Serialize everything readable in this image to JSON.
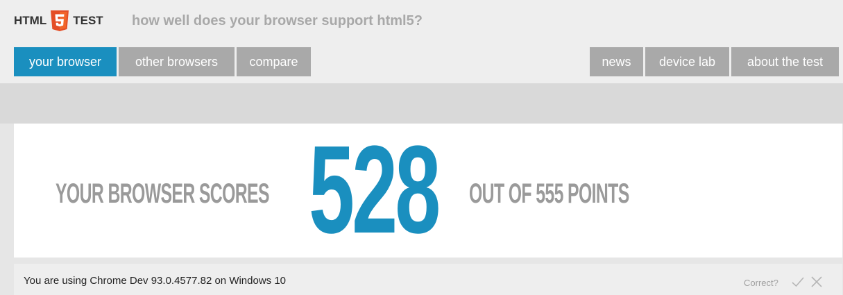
{
  "header": {
    "logo": {
      "left_text": "HTML",
      "shield_glyph": "5",
      "right_text": "TEST"
    },
    "tagline": "how well does your browser support html5?"
  },
  "nav": {
    "left_tabs": [
      {
        "label": "your browser",
        "active": true
      },
      {
        "label": "other browsers",
        "active": false
      },
      {
        "label": "compare",
        "active": false
      }
    ],
    "right_tabs": [
      {
        "label": "news"
      },
      {
        "label": "device lab"
      },
      {
        "label": "about the test"
      }
    ]
  },
  "score": {
    "prefix": "YOUR BROWSER SCORES",
    "value": "528",
    "suffix": "OUT OF 555 POINTS"
  },
  "status": {
    "text": "You are using Chrome Dev 93.0.4577.82 on Windows 10",
    "correct_label": "Correct?",
    "confirm_icon": "checkmark-icon",
    "reject_icon": "close-icon"
  },
  "colors": {
    "accent": "#1a8fbf",
    "shield": "#e44d26",
    "tab_inactive": "#a9a9a9",
    "muted_text": "#9a9a9a"
  }
}
